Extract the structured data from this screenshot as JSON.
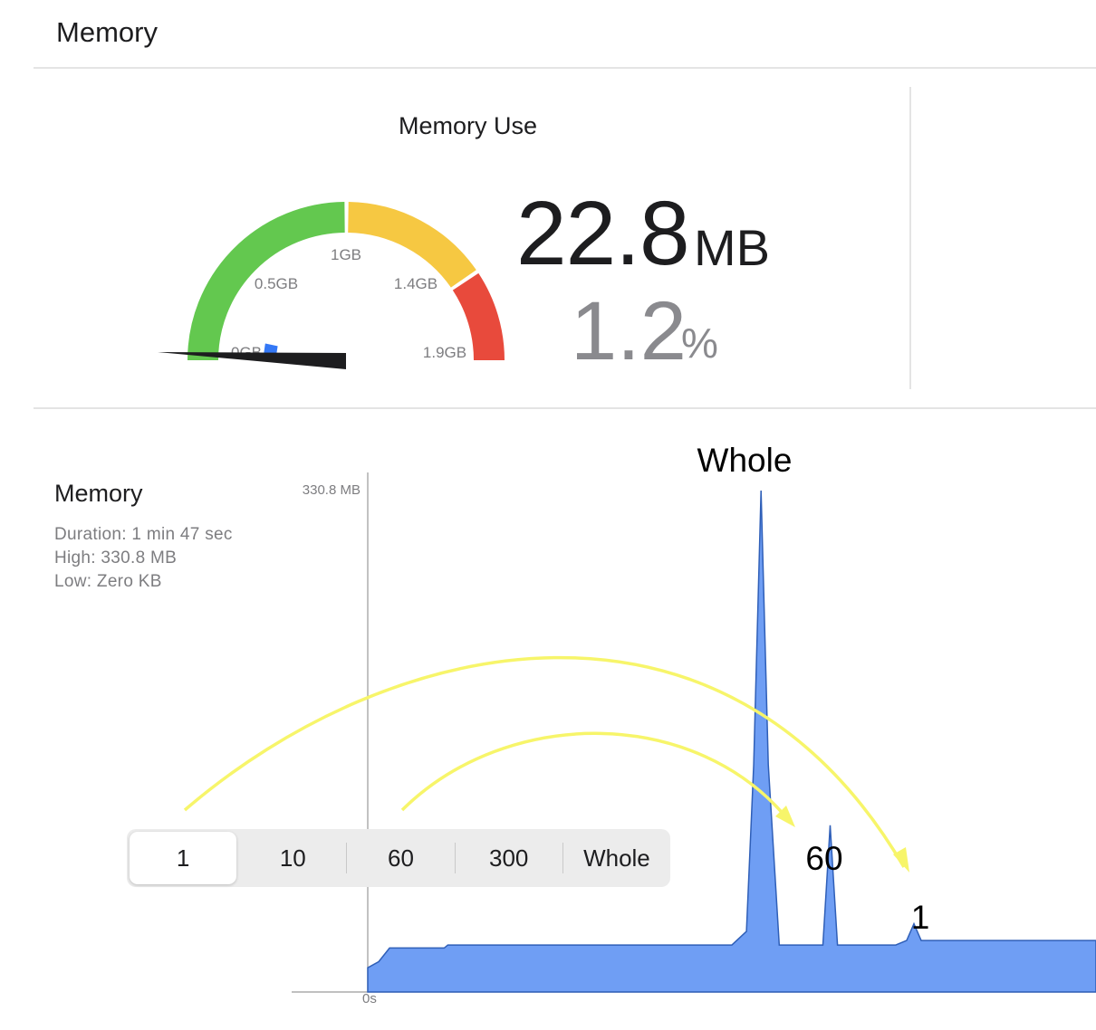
{
  "header": {
    "title": "Memory"
  },
  "gauge": {
    "title": "Memory Use",
    "labels": [
      "0GB",
      "0.5GB",
      "1GB",
      "1.4GB",
      "1.9GB"
    ],
    "value_fraction": 0.012,
    "zone_colors": {
      "green": "#63c84f",
      "yellow": "#f6c842",
      "red": "#e84a3c",
      "needle_indicator": "#3478f6"
    },
    "big_value": "22.8",
    "big_unit": "MB",
    "percent_value": "1.2",
    "percent_unit": "%"
  },
  "graph": {
    "title": "Memory",
    "duration": "Duration: 1 min 47 sec",
    "high": "High: 330.8 MB",
    "low": "Low: Zero KB",
    "y_max_label": "330.8 MB",
    "x_start_label": "0s",
    "fill_color": "#6f9ef4",
    "stroke_color": "#2f5fb8"
  },
  "chart_data": {
    "type": "area",
    "ylim": [
      0,
      330.8
    ],
    "ylabel": "",
    "xlabel": "",
    "points": [
      [
        0,
        16
      ],
      [
        3,
        20
      ],
      [
        6,
        29
      ],
      [
        21,
        29
      ],
      [
        22,
        31
      ],
      [
        100,
        31
      ],
      [
        104,
        40
      ],
      [
        106,
        150
      ],
      [
        108,
        330.8
      ],
      [
        110,
        150
      ],
      [
        113,
        31
      ],
      [
        125,
        31
      ],
      [
        127,
        110
      ],
      [
        129,
        31
      ],
      [
        145,
        31
      ],
      [
        148,
        34
      ],
      [
        150,
        45
      ],
      [
        152,
        34
      ],
      [
        200,
        34
      ]
    ],
    "x_max": 200
  },
  "segmented": {
    "options": [
      "1",
      "10",
      "60",
      "300",
      "Whole"
    ],
    "selected_index": 0
  },
  "annotations": {
    "whole": "Whole",
    "sixty": "60",
    "one": "1",
    "arrow_color": "#f7f56a"
  }
}
